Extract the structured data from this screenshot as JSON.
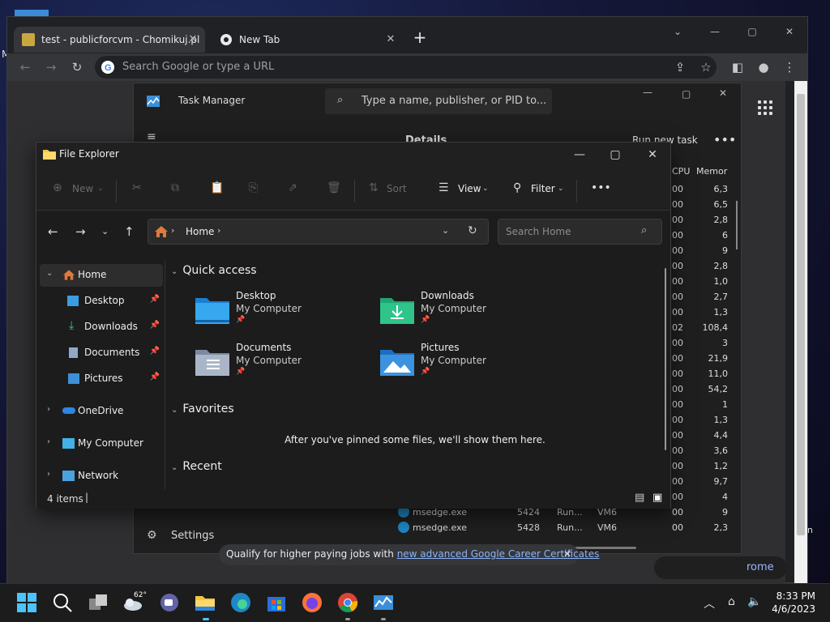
{
  "desktop": {
    "left_text": "M",
    "right_text": "n"
  },
  "browser": {
    "tabs": [
      {
        "label": "test - publicforcvm - Chomikuj.pl"
      },
      {
        "label": "New Tab"
      }
    ],
    "omnibox_placeholder": "Search Google or type a URL",
    "career_text": "Qualify for higher paying jobs with ",
    "career_link": "new advanced Google Career Certificates",
    "chrome_pill": "rome"
  },
  "task_manager": {
    "title": "Task Manager",
    "search_placeholder": "Type a name, publisher, or PID to...",
    "section": "Details",
    "run_new_task": "Run new task",
    "col_cpu": "CPU",
    "col_memory": "Memor",
    "cpu_values": [
      "00",
      "00",
      "00",
      "00",
      "00",
      "00",
      "00",
      "00",
      "00",
      "02",
      "00",
      "00",
      "00",
      "00",
      "00",
      "00",
      "00",
      "00",
      "00",
      "00",
      "00",
      "00",
      "00"
    ],
    "mem_values": [
      "6,3",
      "6,5",
      "2,8",
      "6",
      "9",
      "2,8",
      "1,0",
      "2,7",
      "1,3",
      "108,4",
      "3",
      "21,9",
      "11,0",
      "54,2",
      "1",
      "1,3",
      "4,4",
      "3,6",
      "1,2",
      "9,7",
      "4",
      "9",
      "2,3"
    ],
    "rows": [
      {
        "name": "msedge.exe",
        "pid": "5424",
        "status": "Run...",
        "user": "VM6"
      },
      {
        "name": "msedge.exe",
        "pid": "5428",
        "status": "Run...",
        "user": "VM6"
      }
    ],
    "settings": "Settings"
  },
  "file_explorer": {
    "title": "File Explorer",
    "cmd": {
      "new": "New",
      "sort": "Sort",
      "view": "View",
      "filter": "Filter"
    },
    "address": "Home",
    "search_placeholder": "Search Home",
    "sidebar": [
      {
        "label": "Home"
      },
      {
        "label": "Desktop"
      },
      {
        "label": "Downloads"
      },
      {
        "label": "Documents"
      },
      {
        "label": "Pictures"
      },
      {
        "label": "OneDrive"
      },
      {
        "label": "My Computer"
      },
      {
        "label": "Network"
      }
    ],
    "sections": {
      "quick": "Quick access",
      "favorites": "Favorites",
      "recent": "Recent"
    },
    "tiles": [
      {
        "name": "Desktop",
        "sub": "My Computer"
      },
      {
        "name": "Downloads",
        "sub": "My Computer"
      },
      {
        "name": "Documents",
        "sub": "My Computer"
      },
      {
        "name": "Pictures",
        "sub": "My Computer"
      }
    ],
    "empty_favorites": "After you've pinned some files, we'll show them here.",
    "status": "4 items"
  },
  "taskbar": {
    "weather_temp": "62°",
    "time": "8:33 PM",
    "date": "4/6/2023"
  },
  "colors": {
    "accent": "#60cdff",
    "folder_yellow": "#f4c542",
    "chrome_bg": "#202124"
  }
}
